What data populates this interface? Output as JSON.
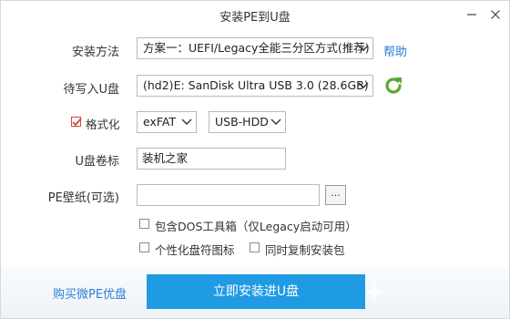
{
  "window": {
    "title": "安装PE到U盘",
    "minimize_icon": "minimize-icon",
    "close_icon": "close-icon"
  },
  "form": {
    "install_method": {
      "label": "安装方法",
      "value": "方案一：UEFI/Legacy全能三分区方式(推荐)",
      "help_link": "帮助"
    },
    "target_drive": {
      "label": "待写入U盘",
      "value": "(hd2)E: SanDisk Ultra USB 3.0 (28.6GB)",
      "refresh_icon": "refresh-icon",
      "refresh_color": "#5aa832"
    },
    "format": {
      "label": "格式化",
      "checked": true,
      "filesystem": "exFAT",
      "boot_mode": "USB-HDD"
    },
    "volume_label": {
      "label": "U盘卷标",
      "value": "装机之家"
    },
    "wallpaper": {
      "label": "PE壁纸(可选)",
      "value": "",
      "browse_label": "..."
    },
    "options": {
      "include_dos": "包含DOS工具箱（仅Legacy启动可用）",
      "custom_icon": "个性化盘符图标",
      "copy_installer": "同时复制安装包"
    }
  },
  "footer": {
    "buy_link": "购买微PE优盘",
    "install_button": "立即安装进U盘",
    "accent_color": "#1f9be3"
  }
}
